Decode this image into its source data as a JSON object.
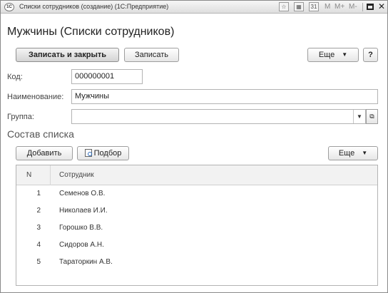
{
  "window": {
    "title": "Списки сотрудников (создание) (1С:Предприятие)",
    "app_icon_text": "1С",
    "toolbar": {
      "m": "M",
      "m_plus": "M+",
      "m_minus": "M-"
    }
  },
  "page_title": "Мужчины (Списки сотрудников)",
  "command_bar": {
    "save_close": "Записать и закрыть",
    "save": "Записать",
    "more": "Еще",
    "help": "?"
  },
  "form": {
    "code_label": "Код:",
    "code_value": "000000001",
    "name_label": "Наименование:",
    "name_value": "Мужчины",
    "group_label": "Группа:",
    "group_value": ""
  },
  "list_section": {
    "title": "Состав списка",
    "add": "Добавить",
    "pick": "Подбор",
    "more": "Еще"
  },
  "table": {
    "columns": [
      "N",
      "Сотрудник"
    ],
    "rows": [
      {
        "n": "1",
        "name": "Семенов О.В."
      },
      {
        "n": "2",
        "name": "Николаев И.И."
      },
      {
        "n": "3",
        "name": "Горошко В.В."
      },
      {
        "n": "4",
        "name": "Сидоров А.Н."
      },
      {
        "n": "5",
        "name": "Тараторкин А.В."
      }
    ]
  }
}
